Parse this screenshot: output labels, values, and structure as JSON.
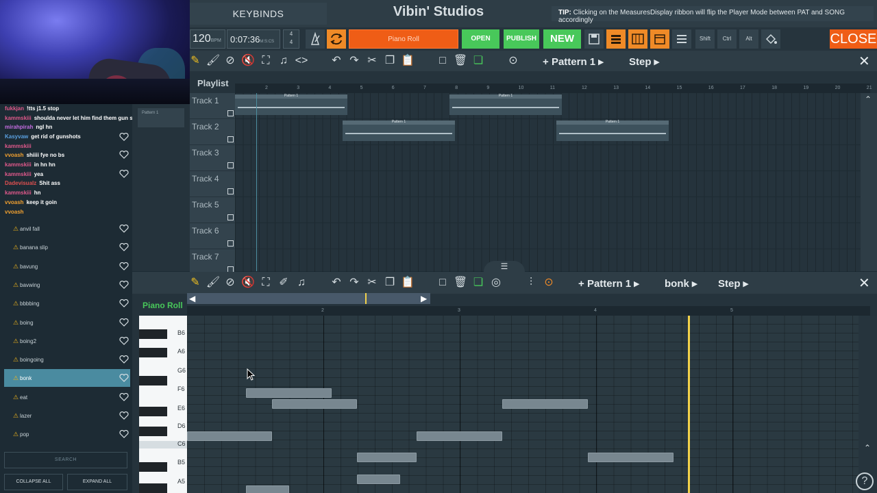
{
  "header": {
    "keybinds": "KEYBINDS",
    "title": "Vibin' Studios",
    "tip_label": "TIP:",
    "tip_text": "Clicking on the MeasuresDisplay ribbon will flip the Player Mode between PAT and SONG accordingly"
  },
  "transport": {
    "bpm": "120",
    "bpm_unit": "BPM",
    "time": "0:07:36",
    "time_unit": "M:S:CS",
    "timesig_top": "4",
    "timesig_bottom": "4",
    "piano_roll_btn": "Piano Roll",
    "open_btn": "OPEN",
    "publish_btn": "PUBLISH",
    "new_btn": "NEW",
    "shift": "Shift",
    "ctrl": "Ctrl",
    "alt": "Alt",
    "close_btn": "CLOSE"
  },
  "playlist": {
    "label": "Playlist",
    "pattern_selector": "Pattern 1",
    "mode_selector": "Step",
    "ruler": [
      "2",
      "3",
      "4",
      "5",
      "6",
      "7",
      "8",
      "9",
      "10",
      "11",
      "12",
      "13",
      "14",
      "15",
      "16",
      "17",
      "18",
      "19",
      "20",
      "21"
    ],
    "tracks": [
      "Track 1",
      "Track 2",
      "Track 3",
      "Track 4",
      "Track 5",
      "Track 6",
      "Track 7"
    ],
    "clip_label": "Pattern 1",
    "side_clip_label": "Pattern 1"
  },
  "piano_roll": {
    "label": "Piano Roll",
    "pattern_selector": "Pattern 1",
    "instrument_selector": "bonk",
    "mode_selector": "Step",
    "ruler": [
      "2",
      "3",
      "4",
      "5"
    ],
    "keys": [
      "B6",
      "A6",
      "G6",
      "F6",
      "E6",
      "D6",
      "C6",
      "B5",
      "A5"
    ]
  },
  "chat": [
    {
      "user": "fukkjan",
      "msg": "!tts j1.5 stop",
      "color": "#e0598b"
    },
    {
      "user": "kammskiii",
      "msg": "shoulda never let him find them gun shots",
      "color": "#e0598b"
    },
    {
      "user": "mirahpirah",
      "msg": "ngl hn",
      "color": "#c46de0"
    },
    {
      "user": "Kasyvaw",
      "msg": "get rid of gunshots",
      "color": "#5aa0e0"
    },
    {
      "user": "kammskiii",
      "msg": "",
      "color": "#e0598b"
    },
    {
      "user": "vvoash",
      "msg": "shiiii fye no bs",
      "color": "#f0a030"
    },
    {
      "user": "kammskiii",
      "msg": "in hn hn",
      "color": "#e0598b"
    },
    {
      "user": "kammskiii",
      "msg": "yea",
      "color": "#e0598b"
    },
    {
      "user": "Dadevisualz",
      "msg": "Shit ass",
      "color": "#e05050"
    },
    {
      "user": "kammskiii",
      "msg": "hn",
      "color": "#e0598b"
    },
    {
      "user": "vvoash",
      "msg": "keep it goin",
      "color": "#f0a030"
    },
    {
      "user": "vvoash",
      "msg": "",
      "color": "#f0a030"
    }
  ],
  "sounds": [
    "anvil fall",
    "banana slip",
    "bavung",
    "bavwing",
    "bbbbing",
    "boing",
    "boing2",
    "boingoing",
    "bonk",
    "eat",
    "lazer",
    "pop"
  ],
  "selected_sound": "bonk",
  "search_placeholder": "SEARCH",
  "collapse_all": "COLLAPSE ALL",
  "expand_all": "EXPAND ALL",
  "help": "?"
}
